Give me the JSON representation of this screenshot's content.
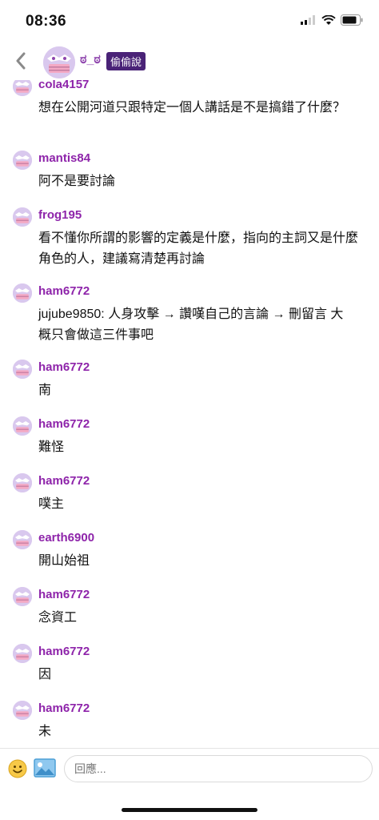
{
  "status_bar": {
    "time": "08:36"
  },
  "header": {
    "nickname": "ಠ_ಠ",
    "tag": "偷偷說"
  },
  "messages": [
    {
      "user": "cola4157",
      "text": "想在公開河道只跟特定一個人講話是不是搞錯了什麼？"
    },
    {
      "user": "mantis84",
      "text": "阿不是要討論"
    },
    {
      "user": "frog195",
      "text": "看不懂你所謂的影響的定義是什麼，指向的主詞又是什麼角色的人，建議寫清楚再討論"
    },
    {
      "user": "ham6772",
      "text": "jujube9850: 人身攻擊 → 讚嘆自己的言論 → 刪留言 大概只會做這三件事吧"
    },
    {
      "user": "ham6772",
      "text": "南"
    },
    {
      "user": "ham6772",
      "text": "難怪"
    },
    {
      "user": "ham6772",
      "text": "噗主"
    },
    {
      "user": "earth6900",
      "text": "開山始祖"
    },
    {
      "user": "ham6772",
      "text": "念資工"
    },
    {
      "user": "ham6772",
      "text": "因"
    },
    {
      "user": "ham6772",
      "text": "未"
    }
  ],
  "composer": {
    "placeholder": "回應..."
  },
  "icons": {
    "back": "chevron-left-icon",
    "emoji": "smiley-icon",
    "image": "image-icon"
  },
  "colors": {
    "username": "#8e24aa",
    "tag_bg": "#4a2377"
  }
}
